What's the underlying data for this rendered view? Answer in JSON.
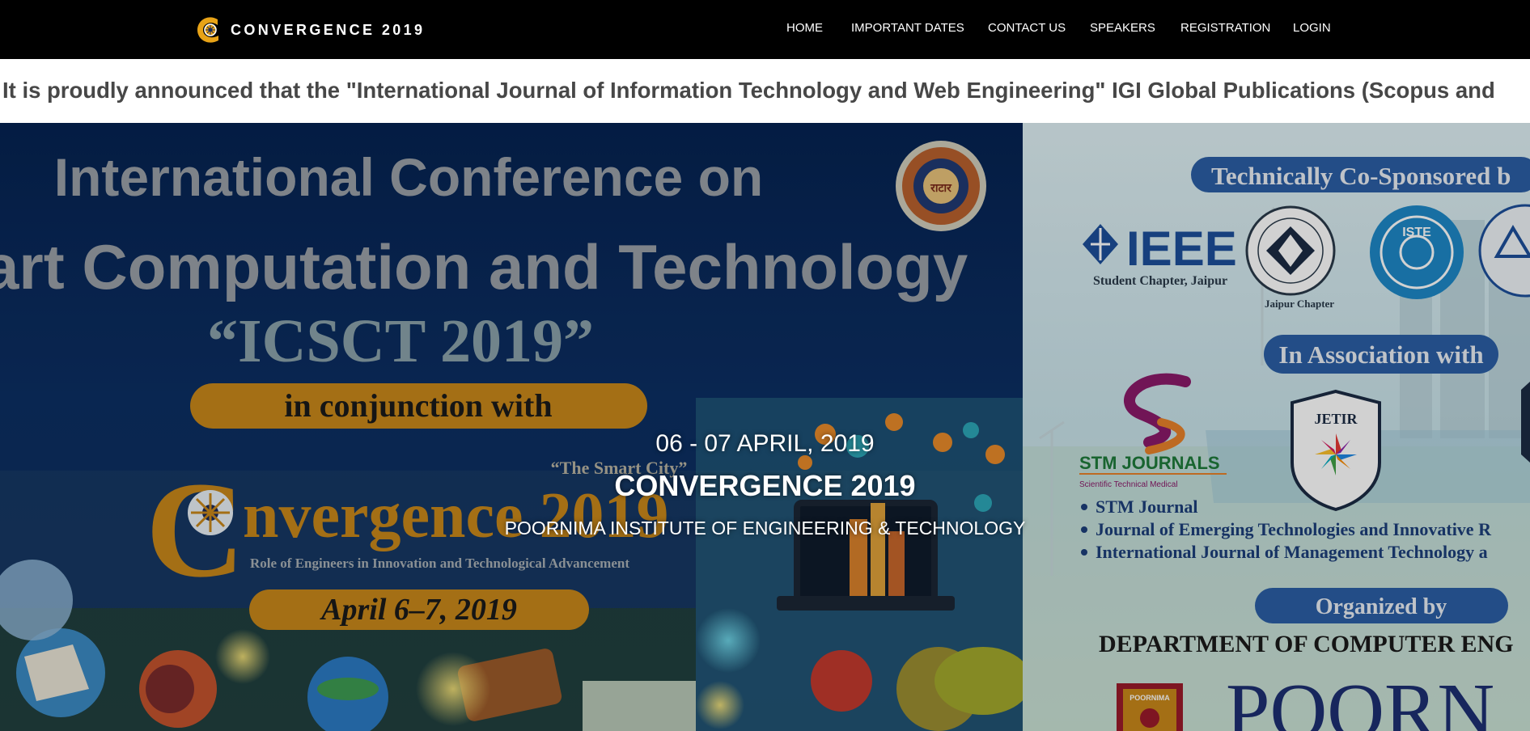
{
  "colors": {
    "navbar_bg": "#000000",
    "brand_accent": "#e8a317",
    "ticker_text": "#474747",
    "poster_left_bg": "#0a2a5a",
    "poster_right_bg": "#d7ecf2"
  },
  "navbar": {
    "brand": "CONVERGENCE 2019",
    "brand_icon": "convergence-logo-icon",
    "links": [
      "HOME",
      "IMPORTANT DATES",
      "CONTACT US",
      "SPEAKERS",
      "REGISTRATION",
      "LOGIN"
    ]
  },
  "ticker": {
    "text": "It is proudly announced that the \"International Journal of Information Technology and Web Engineering\" IGI Global Publications (Scopus and"
  },
  "hero": {
    "date": "06 - 07 APRIL, 2019",
    "title": "CONVERGENCE 2019",
    "subtitle": "POORNIMA INSTITUTE OF ENGINEERING & TECHNOLOGY",
    "poster_left": {
      "line1": "International Conference on",
      "line2": "art Computation and Technology",
      "line3": "“ICSCT 2019”",
      "pill1": "in conjunction with",
      "tagline": "“The Smart City”",
      "brand_c": "C",
      "brand_rest": "nvergence 2019",
      "theme": "Role of Engineers in Innovation and Technological Advancement",
      "pill2": "April 6–7, 2019",
      "seal": "राटार"
    },
    "poster_right": {
      "header": "Technically Co-Sponsored b",
      "ieee": "IEEE",
      "ieee_sub": "Student Chapter, Jaipur",
      "csi_sub": "Jaipur Chapter",
      "iste": "ISTE",
      "association": "In Association with",
      "stm": "STM JOURNALS",
      "stm_sub": "Scientific        Technical        Medical",
      "jetir": "JETIR",
      "bullets": [
        "STM Journal",
        "Journal of Emerging Technologies and Innovative R",
        "International Journal of Management Technology a"
      ],
      "organized": "Organized by",
      "department": "DEPARTMENT OF COMPUTER ENG",
      "poornima_badge": "POORNIMA",
      "poornima_big": "POORN"
    }
  }
}
